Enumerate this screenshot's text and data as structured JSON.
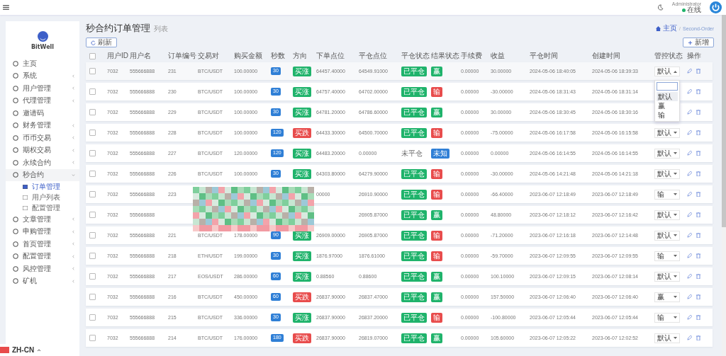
{
  "topbar": {
    "user": "Administrator",
    "status": "在线"
  },
  "sidebar": {
    "brand": "BitWell",
    "items": [
      {
        "label": "主页"
      },
      {
        "label": "系统",
        "expanded": false
      },
      {
        "label": "用户管理",
        "expanded": false
      },
      {
        "label": "代理管理",
        "expanded": false
      },
      {
        "label": "邀请码"
      },
      {
        "label": "财务管理",
        "expanded": false
      },
      {
        "label": "币币交易",
        "expanded": false
      },
      {
        "label": "期权交易",
        "expanded": false
      },
      {
        "label": "永续合约",
        "expanded": false
      },
      {
        "label": "秒合约",
        "expanded": true,
        "children": [
          {
            "label": "订单管理",
            "selected": true
          },
          {
            "label": "用户列表",
            "selected": false
          },
          {
            "label": "配置管理",
            "selected": false
          }
        ]
      },
      {
        "label": "文章管理",
        "expanded": false
      },
      {
        "label": "申购管理",
        "expanded": false
      },
      {
        "label": "首页管理",
        "expanded": false
      },
      {
        "label": "配置管理",
        "expanded": false
      },
      {
        "label": "风控管理",
        "expanded": false
      },
      {
        "label": "矿机",
        "expanded": false
      }
    ],
    "language": "ZH-CN"
  },
  "page": {
    "title": "秒合约订单管理",
    "subtitle": "列表",
    "breadcrumb": [
      "主页",
      "/",
      "Second-Order"
    ],
    "refresh_button": "刷新",
    "add_button": "新增"
  },
  "table": {
    "select_all_checked": false,
    "columns": [
      "用户ID",
      "用户名",
      "订单编号",
      "交易对",
      "购买金额",
      "秒数",
      "方向",
      "下单点位",
      "平仓点位",
      "平仓状态",
      "结果状态",
      "手续费",
      "收益",
      "平仓时间",
      "创建时间",
      "管控状态",
      "操作"
    ],
    "rows": [
      {
        "checked": false,
        "uid": "7032",
        "username": "555666888",
        "order": "231",
        "pair": "BTC/USDT",
        "amount": "100.00000",
        "seconds": "30",
        "direction": {
          "text": "买涨",
          "color": "#1fb36b"
        },
        "open": "64457.40000",
        "close": "64549.91000",
        "close_status": {
          "text": "已平仓",
          "kind": "badge"
        },
        "result": {
          "text": "赢",
          "color": "#1fb36b"
        },
        "fee": "0.00000",
        "profit": "30.00000",
        "close_time": "2024-05-06 18:40:05",
        "create_time": "2024-05-06 18:39:33",
        "control": "默认",
        "dropdown_open": true
      },
      {
        "checked": false,
        "uid": "7032",
        "username": "555666888",
        "order": "230",
        "pair": "BTC/USDT",
        "amount": "100.00000",
        "seconds": "30",
        "direction": {
          "text": "买涨",
          "color": "#1fb36b"
        },
        "open": "64757.40000",
        "close": "64702.00000",
        "close_status": {
          "text": "已平仓",
          "kind": "badge"
        },
        "result": {
          "text": "输",
          "color": "#e84c4c"
        },
        "fee": "0.00000",
        "profit": "-30.00000",
        "close_time": "2024-05-06 18:31:43",
        "create_time": "2024-05-06 18:31:14",
        "dropdown_open": false
      },
      {
        "checked": false,
        "uid": "7032",
        "username": "555666888",
        "order": "229",
        "pair": "BTC/USDT",
        "amount": "100.00000",
        "seconds": "30",
        "direction": {
          "text": "买涨",
          "color": "#1fb36b"
        },
        "open": "64781.20000",
        "close": "64786.60000",
        "close_status": {
          "text": "已平仓",
          "kind": "badge"
        },
        "result": {
          "text": "赢",
          "color": "#1fb36b"
        },
        "fee": "0.00000",
        "profit": "30.00000",
        "close_time": "2024-05-06 18:30:45",
        "create_time": "2024-05-06 18:30:16",
        "dropdown_open": false
      },
      {
        "checked": false,
        "uid": "7032",
        "username": "555666888",
        "order": "228",
        "pair": "BTC/USDT",
        "amount": "100.00000",
        "seconds": "120",
        "direction": {
          "text": "买跌",
          "color": "#e84c4c"
        },
        "open": "64433.30000",
        "close": "64500.70000",
        "close_status": {
          "text": "已平仓",
          "kind": "badge"
        },
        "result": {
          "text": "输",
          "color": "#e84c4c"
        },
        "fee": "0.00000",
        "profit": "-75.00000",
        "close_time": "2024-05-06 16:17:58",
        "create_time": "2024-05-06 16:15:58",
        "control": "默认",
        "dropdown_open": false
      },
      {
        "checked": false,
        "uid": "7032",
        "username": "555666888",
        "order": "227",
        "pair": "BTC/USDT",
        "amount": "120.00000",
        "seconds": "120",
        "direction": {
          "text": "买涨",
          "color": "#1fb36b"
        },
        "open": "64483.20000",
        "close": "0.00000",
        "close_status": {
          "text": "未平仓",
          "kind": "plain"
        },
        "result": {
          "text": "未知",
          "color": "#2f7fd6"
        },
        "fee": "0.00000",
        "profit": "0.00000",
        "close_time": "2024-05-06 16:14:55",
        "create_time": "2024-05-06 16:14:55",
        "control": "默认",
        "dropdown_open": false
      },
      {
        "checked": false,
        "uid": "7032",
        "username": "555666888",
        "order": "226",
        "pair": "BTC/USDT",
        "amount": "100.00000",
        "seconds": "30",
        "direction": {
          "text": "买涨",
          "color": "#1fb36b"
        },
        "open": "64303.80000",
        "close": "64279.90000",
        "close_status": {
          "text": "已平仓",
          "kind": "badge"
        },
        "result": {
          "text": "输",
          "color": "#e84c4c"
        },
        "fee": "0.00000",
        "profit": "-30.00000",
        "close_time": "2024-05-06 14:21:48",
        "create_time": "2024-05-06 14:21:18",
        "control": "默认",
        "dropdown_open": false
      },
      {
        "checked": false,
        "uid": "7032",
        "username": "555666888",
        "order": "223",
        "open": "00000",
        "close": "26910.90000",
        "close_status": {
          "text": "已平仓",
          "kind": "badge"
        },
        "result": {
          "text": "输",
          "color": "#e84c4c"
        },
        "fee": "0.00000",
        "profit": "-66.40000",
        "close_time": "2023-06-07 12:18:49",
        "create_time": "2023-06-07 12:18:49",
        "control": "输",
        "dropdown_open": false
      },
      {
        "checked": false,
        "uid": "7032",
        "username": "555666888",
        "close": "26905.87000",
        "close_status": {
          "text": "已平仓",
          "kind": "badge"
        },
        "result": {
          "text": "赢",
          "color": "#1fb36b"
        },
        "fee": "0.00000",
        "profit": "48.80000",
        "close_time": "2023-06-07 12:18:12",
        "create_time": "2023-06-07 12:16:42",
        "control": "默认",
        "dropdown_open": false
      },
      {
        "checked": false,
        "uid": "7032",
        "username": "555666888",
        "order": "221",
        "pair": "BTC/USDT",
        "amount": "178.00000",
        "seconds": "90",
        "direction": {
          "text": "买涨",
          "color": "#1fb36b"
        },
        "open": "26909.00000",
        "close": "26905.87000",
        "close_status": {
          "text": "已平仓",
          "kind": "badge"
        },
        "result": {
          "text": "输",
          "color": "#e84c4c"
        },
        "fee": "0.00000",
        "profit": "-71.20000",
        "close_time": "2023-06-07 12:16:18",
        "create_time": "2023-06-07 12:14:48",
        "control": "默认",
        "dropdown_open": false
      },
      {
        "checked": false,
        "uid": "7032",
        "username": "555666888",
        "order": "218",
        "pair": "ETH/USDT",
        "amount": "199.00000",
        "seconds": "30",
        "direction": {
          "text": "买涨",
          "color": "#1fb36b"
        },
        "open": "1876.97000",
        "close": "1876.61000",
        "close_status": {
          "text": "已平仓",
          "kind": "badge"
        },
        "result": {
          "text": "输",
          "color": "#e84c4c"
        },
        "fee": "0.00000",
        "profit": "-59.70000",
        "close_time": "2023-06-07 12:09:55",
        "create_time": "2023-06-07 12:09:55",
        "control": "输",
        "dropdown_open": false
      },
      {
        "checked": false,
        "uid": "7032",
        "username": "555666888",
        "order": "217",
        "pair": "EOS/USDT",
        "amount": "286.00000",
        "seconds": "60",
        "direction": {
          "text": "买涨",
          "color": "#1fb36b"
        },
        "open": "0.88560",
        "close": "0.88600",
        "close_status": {
          "text": "已平仓",
          "kind": "badge"
        },
        "result": {
          "text": "赢",
          "color": "#1fb36b"
        },
        "fee": "0.00000",
        "profit": "100.10000",
        "close_time": "2023-06-07 12:09:15",
        "create_time": "2023-06-07 12:08:14",
        "control": "默认",
        "dropdown_open": false
      },
      {
        "checked": false,
        "uid": "7032",
        "username": "555666888",
        "order": "216",
        "pair": "BTC/USDT",
        "amount": "450.00000",
        "seconds": "60",
        "direction": {
          "text": "买跌",
          "color": "#e84c4c"
        },
        "open": "26837.90000",
        "close": "26837.47000",
        "close_status": {
          "text": "已平仓",
          "kind": "badge"
        },
        "result": {
          "text": "赢",
          "color": "#1fb36b"
        },
        "fee": "0.00000",
        "profit": "157.50000",
        "close_time": "2023-06-07 12:06:40",
        "create_time": "2023-06-07 12:06:40",
        "control": "赢",
        "dropdown_open": false
      },
      {
        "checked": false,
        "uid": "7032",
        "username": "555666888",
        "order": "215",
        "pair": "BTC/USDT",
        "amount": "336.00000",
        "seconds": "30",
        "direction": {
          "text": "买涨",
          "color": "#1fb36b"
        },
        "open": "26837.90000",
        "close": "26837.20000",
        "close_status": {
          "text": "已平仓",
          "kind": "badge"
        },
        "result": {
          "text": "输",
          "color": "#e84c4c"
        },
        "fee": "0.00000",
        "profit": "-100.80000",
        "close_time": "2023-06-07 12:05:44",
        "create_time": "2023-06-07 12:05:44",
        "control": "输",
        "dropdown_open": false
      },
      {
        "checked": false,
        "uid": "7032",
        "username": "555666888",
        "order": "214",
        "pair": "BTC/USDT",
        "amount": "176.00000",
        "seconds": "180",
        "direction": {
          "text": "买跌",
          "color": "#e84c4c"
        },
        "open": "26837.90000",
        "close": "26819.07000",
        "close_status": {
          "text": "已平仓",
          "kind": "badge"
        },
        "result": {
          "text": "赢",
          "color": "#1fb36b"
        },
        "fee": "0.00000",
        "profit": "105.60000",
        "close_time": "2023-06-07 12:05:22",
        "create_time": "2023-06-07 12:02:52",
        "control": "默认",
        "dropdown_open": false
      }
    ],
    "dropdown_options": [
      {
        "label": "默认",
        "selected": true
      },
      {
        "label": "赢",
        "selected": false
      },
      {
        "label": "输",
        "selected": false
      }
    ]
  }
}
